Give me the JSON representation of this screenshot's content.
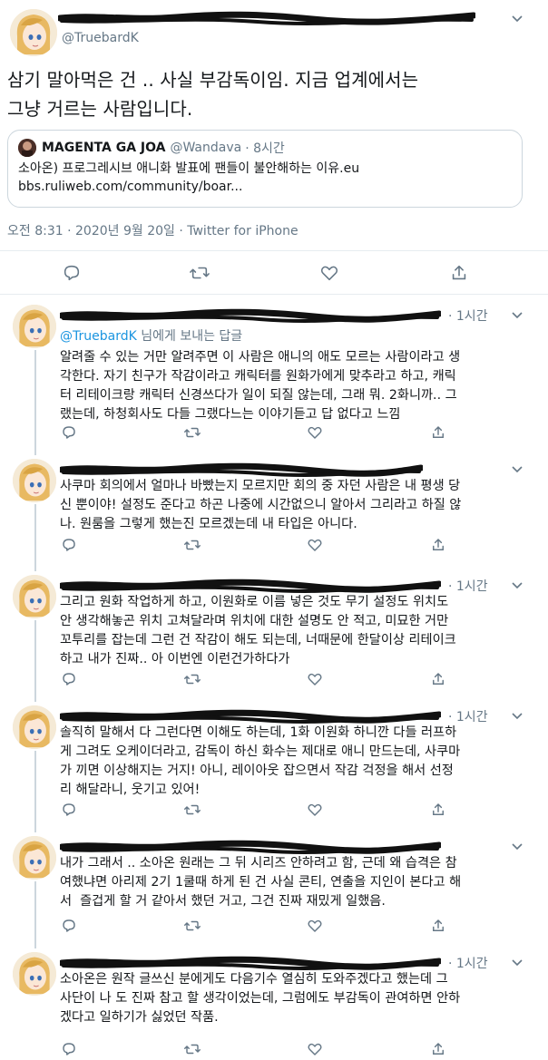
{
  "main_tweet": {
    "handle": "@TruebardK",
    "text_line1": "삼기 말아먹은 건 .. 사실 부감독이임. 지금 업계에서는",
    "text_line2": "그냥 거르는 사람입니다.",
    "quote": {
      "name": "MAGENTA GA JOA",
      "handle": "@Wandava",
      "time": "· 8시간",
      "line1": "소아온) 프로그레시브 애니화 발표에 팬들이 불안해하는 이유.eu",
      "line2": "bbs.ruliweb.com/community/boar..."
    },
    "meta": "오전 8:31 · 2020년 9월 20일 · Twitter for iPhone"
  },
  "replies": [
    {
      "time": "· 1시간",
      "reply_to_handle": "@TruebardK",
      "reply_to_suffix": " 님에게 보내는 답글",
      "lines": [
        "알려줄 수 있는 거만 알려주면 이 사람은 애니의 애도 모르는 사람이라고 생",
        "각한다. 자기 친구가 작감이라고 캐릭터를 원화가에게 맞추라고 하고, 캐릭",
        "터 리테이크랑 캐릭터 신경쓰다가 일이 되질 않는데, 그래 뭐. 2화니까.. 그",
        "랬는데, 하청회사도 다들 그랬다느는 이야기듣고 답 없다고 느낌"
      ]
    },
    {
      "time": "",
      "lines": [
        "사쿠마 회의에서 얼마나 바빴는지 모르지만 회의 중 자던 사람은 내 평생 당",
        "신 뿐이야! 설정도 준다고 하곤 나중에 시간없으니 알아서 그리라고 하질 않",
        "나. 원룸을 그렇게 했는진 모르겠는데 내 타입은 아니다."
      ]
    },
    {
      "time": "· 1시간",
      "lines": [
        "그리고 원화 작업하게 하고, 이원화로 이름 넣은 것도 무기 설정도 위치도",
        "안 생각해놓곤 위치 고쳐달라며 위치에 대한 설명도 안 적고, 미묘한 거만",
        "꼬투리를 잡는데 그런 건 작감이 해도 되는데, 너때문에 한달이상 리테이크",
        "하고 내가 진짜.. 아 이번엔 이런건가하다가"
      ]
    },
    {
      "time": "· 1시간",
      "lines": [
        "솔직히 말해서 다 그런다면 이해도 하는데, 1화 이원화 하니깐 다들 러프하",
        "게 그려도 오케이더라고, 감독이 하신 화수는 제대로 애니 만드는데, 사쿠마",
        "가 끼면 이상해지는 거지! 아니, 레이아웃 잡으면서 작감 걱정을 해서 선정",
        "리 해달라니, 웃기고 있어!"
      ]
    },
    {
      "time": "",
      "lines": [
        "내가 그래서 .. 소아온 원래는 그 뒤 시리즈 안하려고 함, 근데 왜 습격은 참",
        "여했냐면 아리제 2기 1쿨때 하게 된 건 사실 콘티, 연출을 지인이 본다고 해",
        "서  즐겁게 할 거 같아서 했던 거고, 그건 진짜 재밌게 일했음."
      ]
    },
    {
      "time": "· 1시간",
      "lines": [
        "소아온은 원작 글쓰신 분에게도 다음기수 열심히 도와주겠다고 했는데 그",
        "사단이 나 도 진짜 참고 할 생각이었는데, 그럼에도 부감독이 관여하면 안하",
        "겠다고 일하기가 싫었던 작품."
      ]
    }
  ],
  "icons": {
    "reply": "reply-icon",
    "retweet": "retweet-icon",
    "like": "like-icon",
    "share": "share-icon",
    "chevron": "chevron-down-icon"
  },
  "colors": {
    "text": "#14171a",
    "secondary": "#657786",
    "link": "#1b95e0",
    "border": "#e6ecf0"
  }
}
